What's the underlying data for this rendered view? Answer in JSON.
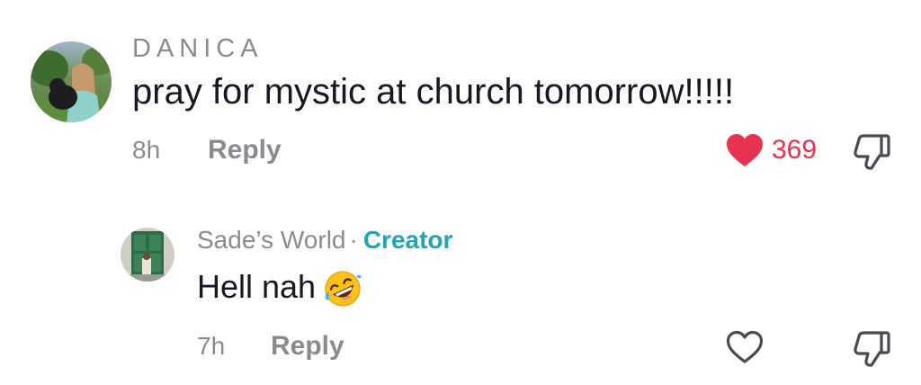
{
  "comments": [
    {
      "username": "DANICA",
      "text": "pray for mystic at church tomorrow!!!!!",
      "time": "8h",
      "reply_label": "Reply",
      "liked": true,
      "like_count": "369",
      "avatar_icon": "avatar-photo-girl-with-dog"
    },
    {
      "username": "Sade’s World",
      "separator": "·",
      "badge": "Creator",
      "text": "Hell nah",
      "emoji": "rolling-on-the-floor-laughing-emoji",
      "time": "7h",
      "reply_label": "Reply",
      "liked": false,
      "like_count": "",
      "avatar_icon": "avatar-photo-green-door"
    }
  ],
  "colors": {
    "like_active": "#e8324f",
    "creator_badge": "#1fa5b4",
    "muted_text": "#8a8b91",
    "primary_text": "#161823"
  }
}
